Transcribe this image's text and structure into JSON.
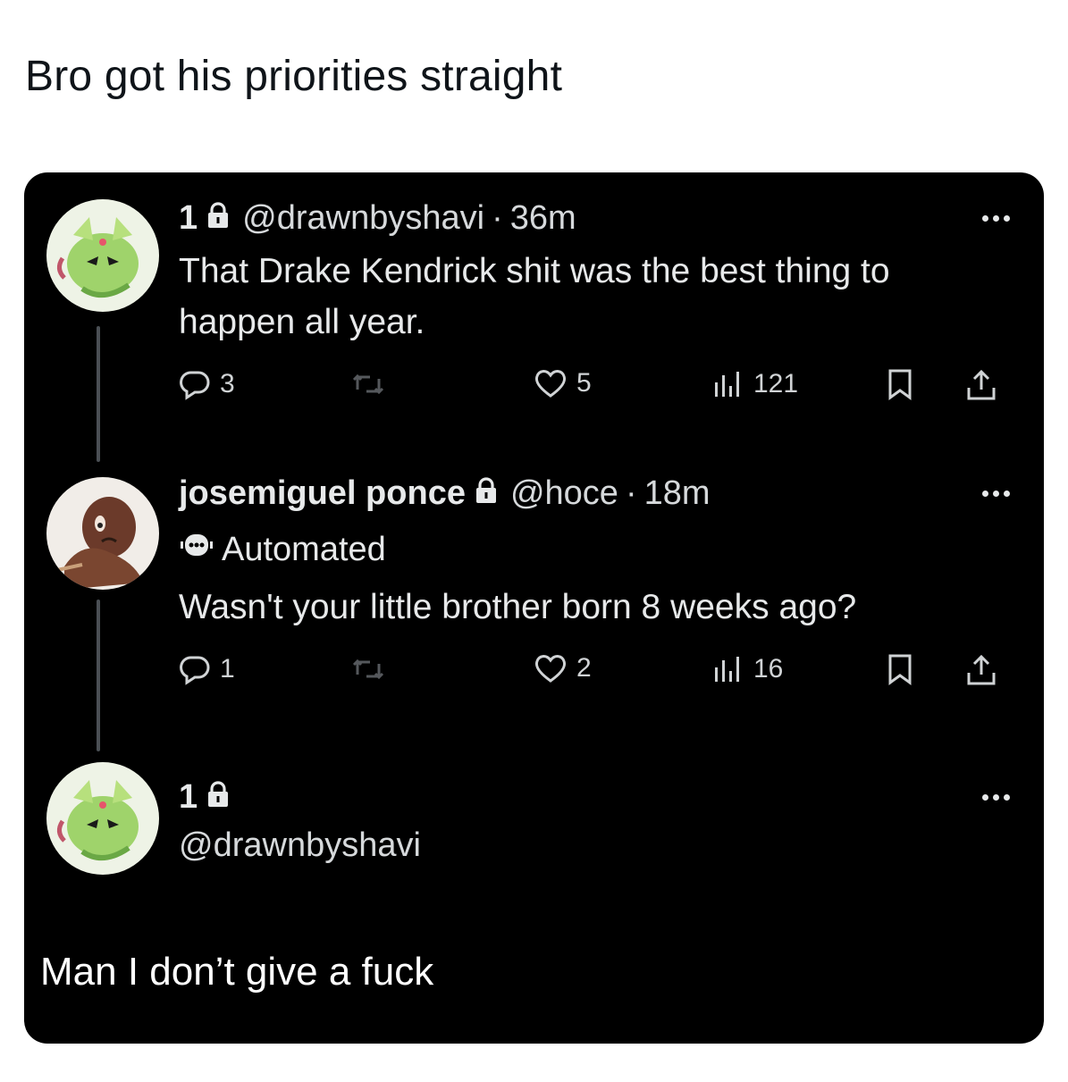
{
  "caption": "Bro got his priorities straight",
  "tweets": [
    {
      "name": "1",
      "handle": "@drawnbyshavi",
      "separator": "·",
      "time": "36m",
      "text": "That Drake Kendrick shit was the best thing to happen all year.",
      "replies": "3",
      "reposts": "",
      "likes": "5",
      "views": "121"
    },
    {
      "name": "josemiguel ponce",
      "handle": "@hoce",
      "separator": "·",
      "time": "18m",
      "label": "Automated",
      "text": "Wasn't your little brother born 8 weeks ago?",
      "replies": "1",
      "reposts": "",
      "likes": "2",
      "views": "16"
    },
    {
      "name": "1",
      "handle": "@drawnbyshavi",
      "text": "Man I don’t give a fuck"
    }
  ],
  "colors": {
    "background": "#000000",
    "text": "#e7e9ea",
    "muted": "#d0d3d5",
    "thread_line": "#4a4f54"
  },
  "icons": [
    "reply-icon",
    "repost-icon",
    "like-icon",
    "views-icon",
    "bookmark-icon",
    "share-icon",
    "lock-icon",
    "more-icon",
    "automated-bot-icon"
  ]
}
